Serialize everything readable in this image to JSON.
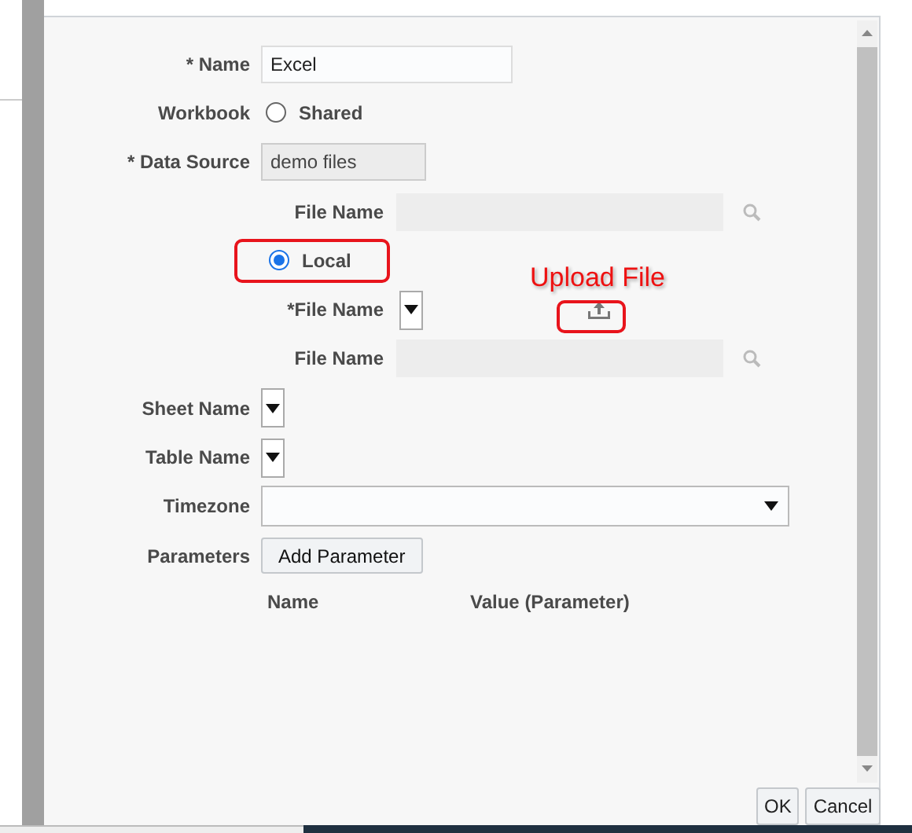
{
  "form": {
    "name": {
      "label": "* Name",
      "value": "Excel"
    },
    "workbook": {
      "label": "Workbook",
      "options": [
        {
          "label": "Shared",
          "selected": false
        },
        {
          "label": "Local",
          "selected": true
        }
      ]
    },
    "data_source": {
      "label": "* Data Source",
      "value": "demo files"
    },
    "shared_file_name": {
      "label": "File Name"
    },
    "local_file_name": {
      "label": "*File Name"
    },
    "local_file_path": {
      "label": "File Name"
    },
    "sheet_name": {
      "label": "Sheet Name"
    },
    "table_name": {
      "label": "Table Name"
    },
    "timezone": {
      "label": "Timezone"
    },
    "parameters": {
      "label": "Parameters",
      "button": "Add Parameter",
      "columns": [
        "Name",
        "Value (Parameter)"
      ]
    }
  },
  "annotation": {
    "callout": "Upload File"
  },
  "buttons": [
    "OK",
    "Cancel"
  ]
}
